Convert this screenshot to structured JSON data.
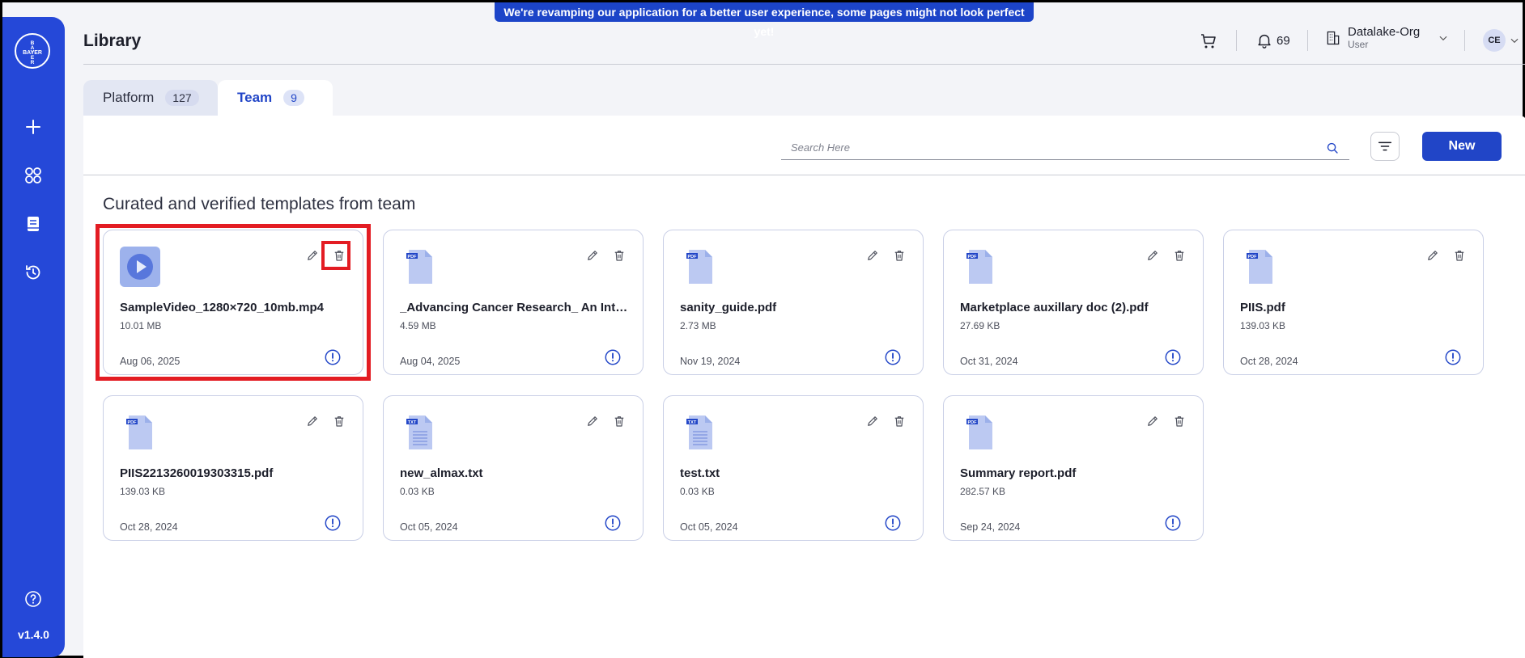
{
  "banner": {
    "text": "We're revamping our application for a better user experience, some pages might not look perfect yet!"
  },
  "sidebar": {
    "logo_text": "BAYER",
    "version": "v1.4.0"
  },
  "header": {
    "title": "Library",
    "notifications_count": "69",
    "org_name": "Datalake-Org",
    "org_role": "User",
    "avatar_initials": "CE"
  },
  "tabs": [
    {
      "label": "Platform",
      "count": "127"
    },
    {
      "label": "Team",
      "count": "9"
    }
  ],
  "toolbar": {
    "search_placeholder": "Search Here",
    "new_label": "New"
  },
  "section": {
    "heading": "Curated and verified templates from team"
  },
  "colors": {
    "accent": "#2145c7",
    "sidebar": "#2548d8",
    "highlight": "#e31c23"
  },
  "files": [
    {
      "name": "SampleVideo_1280×720_10mb.mp4",
      "size": "10.01 MB",
      "date": "Aug 06, 2025",
      "type": "video"
    },
    {
      "name": "_Advancing Cancer Research_ An Inter...",
      "size": "4.59 MB",
      "date": "Aug 04, 2025",
      "type": "pdf"
    },
    {
      "name": "sanity_guide.pdf",
      "size": "2.73 MB",
      "date": "Nov 19, 2024",
      "type": "pdf"
    },
    {
      "name": "Marketplace auxillary doc (2).pdf",
      "size": "27.69 KB",
      "date": "Oct 31, 2024",
      "type": "pdf"
    },
    {
      "name": "PIIS.pdf",
      "size": "139.03 KB",
      "date": "Oct 28, 2024",
      "type": "pdf"
    },
    {
      "name": "PIIS2213260019303315.pdf",
      "size": "139.03 KB",
      "date": "Oct 28, 2024",
      "type": "pdf"
    },
    {
      "name": "new_almax.txt",
      "size": "0.03 KB",
      "date": "Oct 05, 2024",
      "type": "txt"
    },
    {
      "name": "test.txt",
      "size": "0.03 KB",
      "date": "Oct 05, 2024",
      "type": "txt"
    },
    {
      "name": "Summary report.pdf",
      "size": "282.57 KB",
      "date": "Sep 24, 2024",
      "type": "pdf"
    }
  ],
  "icons": {
    "pdf_tag": "PDF",
    "txt_tag": "TXT"
  }
}
